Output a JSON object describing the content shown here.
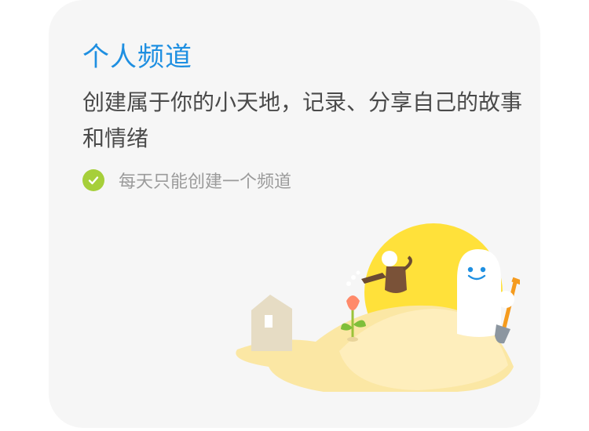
{
  "channel_card": {
    "title": "个人频道",
    "description": "创建属于你的小天地，记录、分享自己的故事和情绪",
    "note": "每天只能创建一个频道",
    "accent_color": "#1e8fe1",
    "check_color": "#a6cf3a",
    "note_icon": "checkmark-icon",
    "illustration": "personal-garden-illustration"
  }
}
